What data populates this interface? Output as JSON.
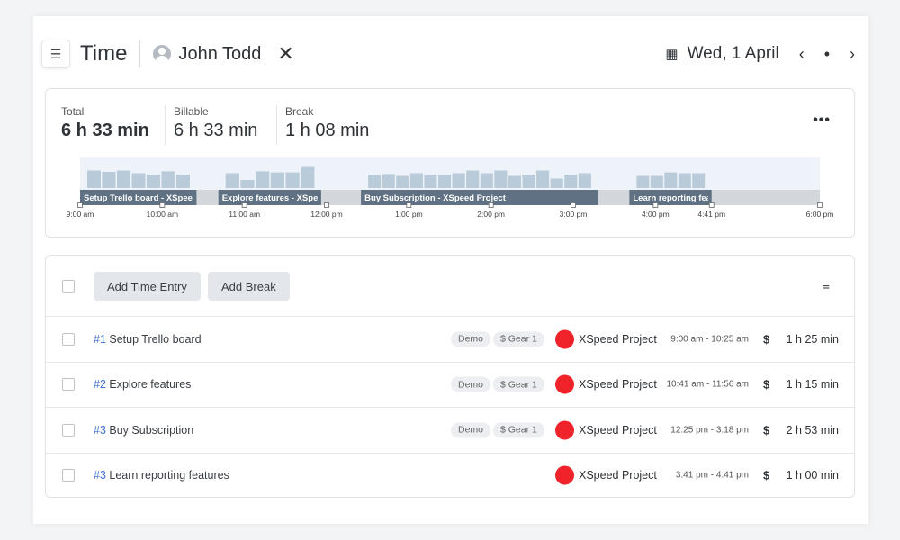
{
  "header": {
    "title": "Time",
    "user": "John Todd",
    "date": "Wed, 1 April",
    "prev": "‹",
    "today": "•",
    "next": "›"
  },
  "summary": {
    "stats": [
      {
        "label": "Total",
        "value": "6 h 33 min"
      },
      {
        "label": "Billable",
        "value": "6 h 33 min"
      },
      {
        "label": "Break",
        "value": "1 h 08 min"
      }
    ],
    "more": "•••"
  },
  "timeline": {
    "range": [
      9,
      18
    ],
    "ticks": [
      {
        "h": 9,
        "label": "9:00 am"
      },
      {
        "h": 10,
        "label": "10:00 am"
      },
      {
        "h": 11,
        "label": "11:00 am"
      },
      {
        "h": 12,
        "label": "12:00 pm"
      },
      {
        "h": 13,
        "label": "1:00 pm"
      },
      {
        "h": 14,
        "label": "2:00 pm"
      },
      {
        "h": 15,
        "label": "3:00 pm"
      },
      {
        "h": 16,
        "label": "4:00 pm"
      },
      {
        "h": 16.683,
        "label": "4:41 pm"
      },
      {
        "h": 18,
        "label": "6:00 pm"
      }
    ],
    "segments": [
      {
        "label": "Setup Trello board - XSpeed Project",
        "start": 9,
        "end": 10.417,
        "activity": [
          0.65,
          0.6,
          0.65,
          0.55,
          0.5,
          0.62,
          0.5
        ]
      },
      {
        "label": "Explore features - XSpeed Project",
        "start": 10.683,
        "end": 11.933,
        "activity": [
          0.55,
          0.3,
          0.62,
          0.58,
          0.58,
          0.78
        ]
      },
      {
        "label": "Buy Subscription - XSpeed Project",
        "start": 12.417,
        "end": 15.3,
        "activity": [
          0.5,
          0.52,
          0.45,
          0.55,
          0.5,
          0.5,
          0.55,
          0.65,
          0.55,
          0.65,
          0.45,
          0.5,
          0.65,
          0.35,
          0.5,
          0.55
        ]
      },
      {
        "label": "Learn reporting features - XSpeed Project",
        "start": 15.683,
        "end": 16.683,
        "activity": [
          0.45,
          0.45,
          0.58,
          0.55,
          0.55
        ]
      }
    ]
  },
  "list": {
    "add_entry": "Add Time Entry",
    "add_break": "Add Break",
    "sort_icon": "≡",
    "rows": [
      {
        "num": "#1",
        "title": "Setup Trello board",
        "tags": [
          "Demo",
          "$ Gear 1"
        ],
        "project": "XSpeed Project",
        "time": "9:00 am - 10:25 am",
        "billable": "$",
        "duration": "1 h 25 min"
      },
      {
        "num": "#2",
        "title": "Explore features",
        "tags": [
          "Demo",
          "$ Gear 1"
        ],
        "project": "XSpeed Project",
        "time": "10:41 am - 11:56 am",
        "billable": "$",
        "duration": "1 h 15 min"
      },
      {
        "num": "#3",
        "title": "Buy Subscription",
        "tags": [
          "Demo",
          "$ Gear 1"
        ],
        "project": "XSpeed Project",
        "time": "12:25 pm - 3:18 pm",
        "billable": "$",
        "duration": "2 h 53 min"
      },
      {
        "num": "#3",
        "title": "Learn reporting features",
        "tags": [],
        "project": "XSpeed Project",
        "time": "3:41 pm - 4:41 pm",
        "billable": "$",
        "duration": "1 h 00 min"
      }
    ]
  },
  "colors": {
    "project": "#f0232a",
    "link": "#3b6fd0",
    "segment": "#5f7183",
    "activity": "#b9cad8"
  }
}
